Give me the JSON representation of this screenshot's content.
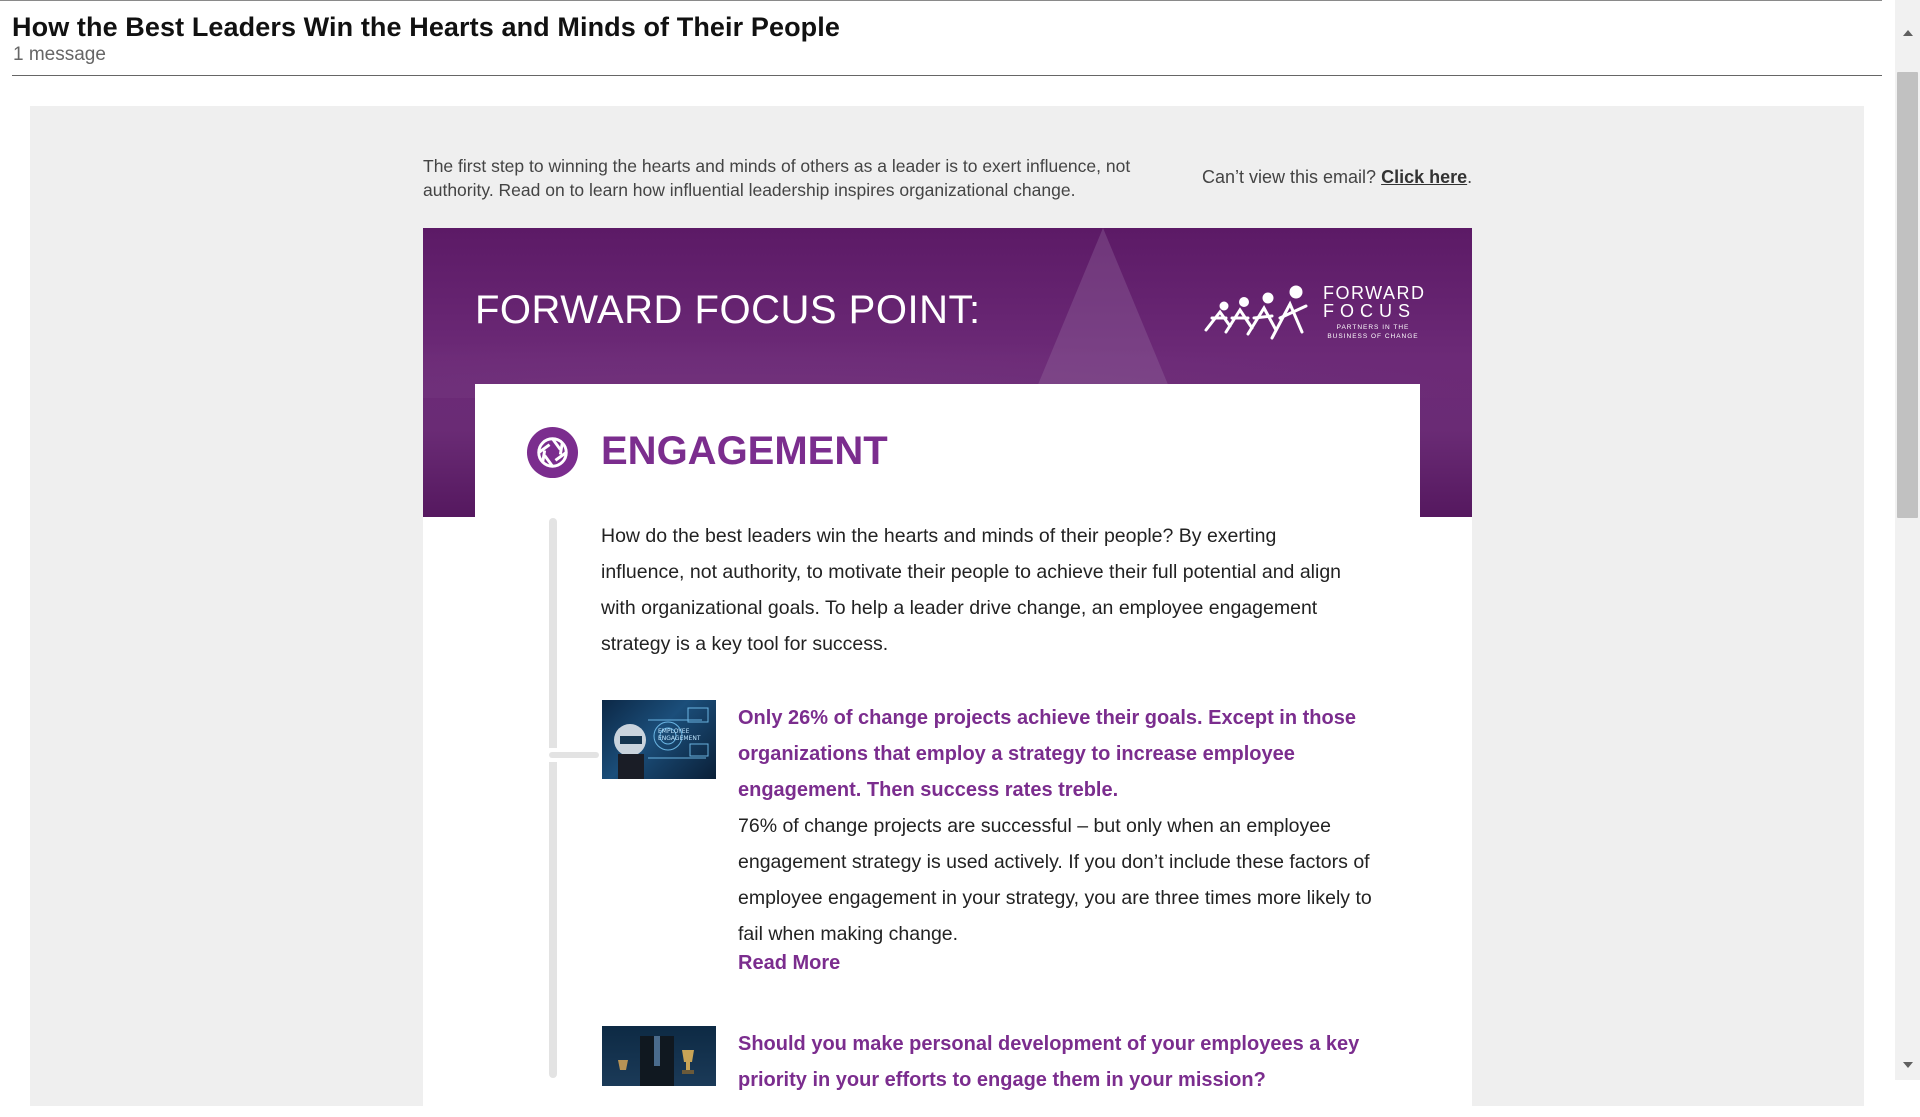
{
  "email": {
    "subject": "How the Best Leaders Win the Hearts and Minds of Their People",
    "message_count": "1 message"
  },
  "preheader": {
    "text": "The first step to winning the hearts and minds of others as a leader is to exert influence, not authority.  Read on to learn how influential leadership inspires organizational change.",
    "cant_view_prefix": "Can’t view this email?",
    "click_here": "Click here",
    "cant_view_suffix": "."
  },
  "banner": {
    "title": "FORWARD FOCUS POINT:",
    "logo_line1": "FORWARD",
    "logo_line2": "FOCUS",
    "logo_tagline": "PARTNERS IN THE BUSINESS OF CHANGE"
  },
  "section": {
    "title": "ENGAGEMENT",
    "intro": "How do the best leaders win the hearts and minds of their people?  By exerting influence, not authority, to motivate their people to achieve their full potential and align with organizational goals.  To help a leader drive change, an employee engagement strategy is a key tool for success."
  },
  "articles": [
    {
      "title": "Only 26% of change projects achieve their goals. Except in those organizations that employ a strategy to increase employee engagement. Then success rates treble.",
      "body": "76% of change projects are successful – but only when an employee engagement strategy is used actively. If you don’t include these factors of employee engagement in your strategy, you are three times more likely to fail when making change.",
      "read_more": "Read More",
      "thumb_text": "EMPLOYEE ENGAGEMENT"
    },
    {
      "title": "Should you make personal development of your employees a key priority in your efforts to engage them in your mission?"
    }
  ],
  "colors": {
    "accent_purple": "#7b2d8e",
    "banner_purple": "#5c1a66",
    "email_background": "#efefef"
  }
}
